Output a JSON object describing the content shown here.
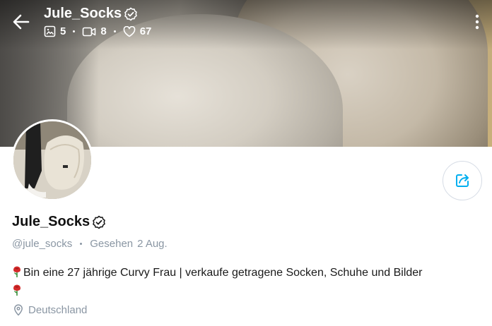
{
  "header": {
    "name": "Jule_Socks",
    "stats": {
      "photos": "5",
      "videos": "8",
      "likes": "67"
    }
  },
  "profile": {
    "name": "Jule_Socks",
    "handle": "@jule_socks",
    "seen_label": "Gesehen",
    "seen_date": "2 Aug.",
    "bio_line1": "Bin eine 27 jährige Curvy Frau | verkaufe getragene Socken, Schuhe und Bilder",
    "location": "Deutschland"
  },
  "icons": {
    "back": "arrow-left-icon",
    "verified": "verified-check-icon",
    "photos": "image-icon",
    "videos": "video-camera-icon",
    "likes": "heart-icon",
    "more": "more-vertical-icon",
    "share": "share-icon",
    "rose": "rose-emoji",
    "location": "location-pin-icon"
  },
  "colors": {
    "accent": "#00aff0",
    "muted": "#8a96a3",
    "text": "#1a1a1a"
  }
}
